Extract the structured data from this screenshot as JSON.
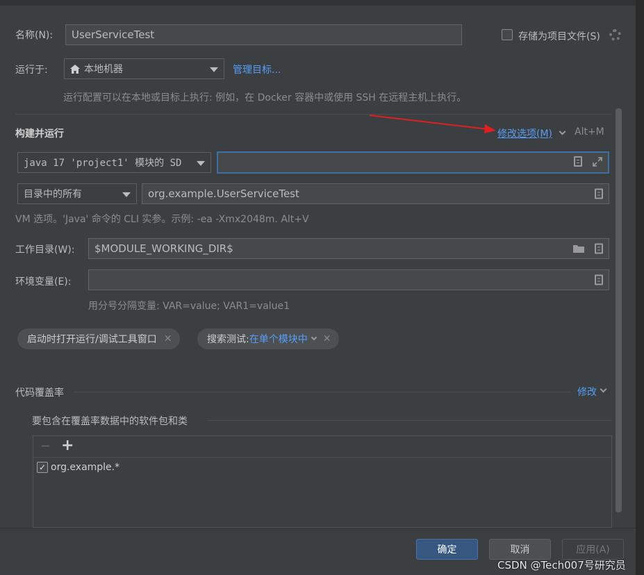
{
  "name_label": "名称(N):",
  "name_value": "UserServiceTest",
  "store_as_project_label": "存储为项目文件(S)",
  "run_on_label": "运行于:",
  "run_on_value": "本地机器",
  "manage_targets_link": "管理目标...",
  "run_on_hint": "运行配置可以在本地或目标上执行: 例如，在 Docker 容器中或使用 SSH 在远程主机上执行。",
  "build_run_title": "构建并运行",
  "modify_options_link": "修改选项(M)",
  "modify_options_shortcut": "Alt+M",
  "jdk_combo_value": "java 17 'project1' 模块的 SD",
  "vm_options_value": "",
  "scope_combo_value": "目录中的所有",
  "class_value": "org.example.UserServiceTest",
  "vm_hint": "VM 选项。'Java' 命令的 CLI 实参。示例: -ea -Xmx2048m. Alt+V",
  "working_dir_label": "工作目录(W):",
  "working_dir_value": "$MODULE_WORKING_DIR$",
  "env_label": "环境变量(E):",
  "env_value": "",
  "env_hint": "用分号分隔变量: VAR=value; VAR1=value1",
  "chip_open_tool_window": "启动时打开运行/调试工具窗口",
  "chip_search_label": "搜索测试: ",
  "chip_search_value": "在单个模块中",
  "coverage_title": "代码覆盖率",
  "coverage_modify_link": "修改",
  "coverage_packages_title": "要包含在覆盖率数据中的软件包和类",
  "coverage_toolbar_minus": "−",
  "coverage_toolbar_plus": "+",
  "coverage_item_checkbox": "✓",
  "coverage_item": "org.example.*",
  "ok_button": "确定",
  "cancel_button": "取消",
  "apply_button": "应用(A)",
  "watermark": "CSDN @Tech007号研究员",
  "colors": {
    "background": "#3c3f41",
    "link": "#589df6",
    "primary_button": "#365880",
    "annotation_arrow": "#e02020"
  }
}
